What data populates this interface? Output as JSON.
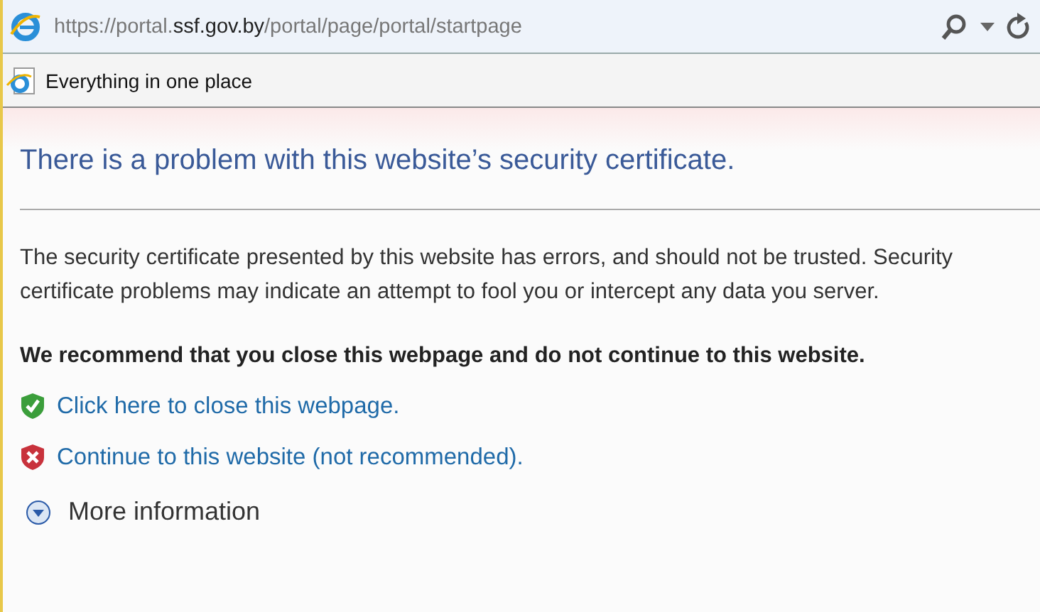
{
  "address_bar": {
    "url_prefix": "https://portal.",
    "url_domain": "ssf.gov.by",
    "url_path": "/portal/page/portal/startpage"
  },
  "tab": {
    "title": "Everything in one place"
  },
  "page": {
    "heading": "There is a problem with this website’s security certificate.",
    "description": "The security certificate presented by this website has errors, and should not be trusted. Security certificate problems may indicate an attempt to fool you or intercept any data you server.",
    "recommendation": "We recommend that you close this webpage and do not continue to this website.",
    "actions": [
      {
        "kind": "safe",
        "label": "Click here to close this webpage."
      },
      {
        "kind": "danger",
        "label": "Continue to this website (not recommended)."
      }
    ],
    "more_info": {
      "label": "More information",
      "expanded": false
    }
  }
}
